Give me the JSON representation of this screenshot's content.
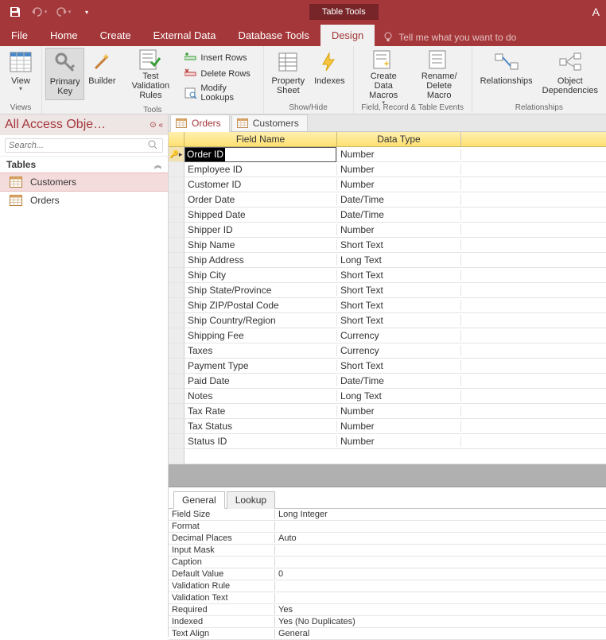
{
  "titlebar": {
    "table_tools": "Table Tools",
    "app_indicator": "A"
  },
  "menu": {
    "file": "File",
    "home": "Home",
    "create": "Create",
    "external_data": "External Data",
    "database_tools": "Database Tools",
    "design": "Design",
    "tell_me": "Tell me what you want to do"
  },
  "ribbon": {
    "views": {
      "view": "View",
      "label": "Views"
    },
    "tools": {
      "primary_key": "Primary\nKey",
      "builder": "Builder",
      "test_rules": "Test Validation\nRules",
      "insert_rows": "Insert Rows",
      "delete_rows": "Delete Rows",
      "modify_lookups": "Modify Lookups",
      "label": "Tools"
    },
    "showhide": {
      "property_sheet": "Property\nSheet",
      "indexes": "Indexes",
      "label": "Show/Hide"
    },
    "events": {
      "create_macros": "Create Data\nMacros",
      "rename_macro": "Rename/\nDelete Macro",
      "label": "Field, Record & Table Events"
    },
    "rel": {
      "relationships": "Relationships",
      "obj_dep": "Object\nDependencies",
      "label": "Relationships"
    }
  },
  "nav": {
    "title": "All Access Obje…",
    "search_placeholder": "Search...",
    "tables": "Tables",
    "items": [
      {
        "label": "Customers",
        "selected": true
      },
      {
        "label": "Orders",
        "selected": false
      }
    ]
  },
  "tabs": [
    {
      "label": "Orders",
      "active": true
    },
    {
      "label": "Customers",
      "active": false
    }
  ],
  "grid": {
    "head_field": "Field Name",
    "head_type": "Data Type",
    "rows": [
      {
        "field": "Order ID",
        "type": "Number",
        "pk": true,
        "selected": true
      },
      {
        "field": "Employee ID",
        "type": "Number"
      },
      {
        "field": "Customer ID",
        "type": "Number"
      },
      {
        "field": "Order Date",
        "type": "Date/Time"
      },
      {
        "field": "Shipped Date",
        "type": "Date/Time"
      },
      {
        "field": "Shipper ID",
        "type": "Number"
      },
      {
        "field": "Ship Name",
        "type": "Short Text"
      },
      {
        "field": "Ship Address",
        "type": "Long Text"
      },
      {
        "field": "Ship City",
        "type": "Short Text"
      },
      {
        "field": "Ship State/Province",
        "type": "Short Text"
      },
      {
        "field": "Ship ZIP/Postal Code",
        "type": "Short Text"
      },
      {
        "field": "Ship Country/Region",
        "type": "Short Text"
      },
      {
        "field": "Shipping Fee",
        "type": "Currency"
      },
      {
        "field": "Taxes",
        "type": "Currency"
      },
      {
        "field": "Payment Type",
        "type": "Short Text"
      },
      {
        "field": "Paid Date",
        "type": "Date/Time"
      },
      {
        "field": "Notes",
        "type": "Long Text"
      },
      {
        "field": "Tax Rate",
        "type": "Number"
      },
      {
        "field": "Tax Status",
        "type": "Number"
      },
      {
        "field": "Status ID",
        "type": "Number"
      }
    ]
  },
  "props": {
    "tab_general": "General",
    "tab_lookup": "Lookup",
    "rows": [
      {
        "name": "Field Size",
        "value": "Long Integer"
      },
      {
        "name": "Format",
        "value": ""
      },
      {
        "name": "Decimal Places",
        "value": "Auto"
      },
      {
        "name": "Input Mask",
        "value": ""
      },
      {
        "name": "Caption",
        "value": ""
      },
      {
        "name": "Default Value",
        "value": "0"
      },
      {
        "name": "Validation Rule",
        "value": ""
      },
      {
        "name": "Validation Text",
        "value": ""
      },
      {
        "name": "Required",
        "value": "Yes"
      },
      {
        "name": "Indexed",
        "value": "Yes (No Duplicates)"
      },
      {
        "name": "Text Align",
        "value": "General"
      }
    ]
  }
}
